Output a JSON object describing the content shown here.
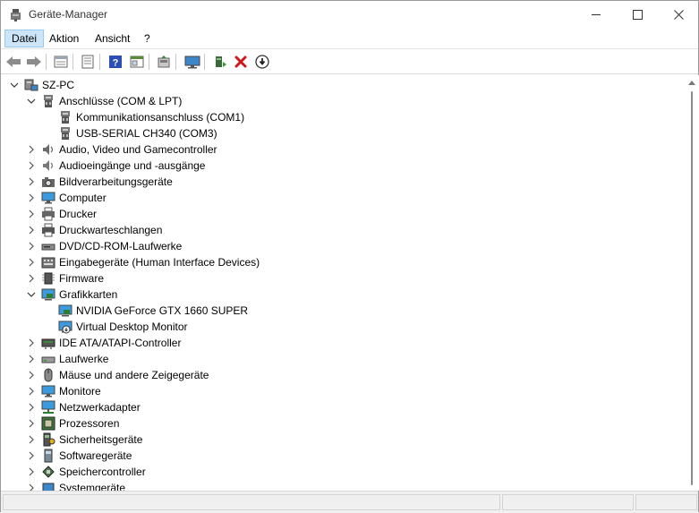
{
  "window": {
    "title": "Geräte-Manager"
  },
  "menu": {
    "items": [
      "Datei",
      "Aktion",
      "Ansicht",
      "?"
    ]
  },
  "tree": {
    "root": "SZ-PC",
    "nodes": [
      "Anschlüsse (COM & LPT)",
      "Kommunikationsanschluss (COM1)",
      "USB-SERIAL CH340 (COM3)",
      "Audio, Video und Gamecontroller",
      "Audioeingänge und -ausgänge",
      "Bildverarbeitungsgeräte",
      "Computer",
      "Drucker",
      "Druckwarteschlangen",
      "DVD/CD-ROM-Laufwerke",
      "Eingabegeräte (Human Interface Devices)",
      "Firmware",
      "Grafikkarten",
      "NVIDIA GeForce GTX 1660 SUPER",
      "Virtual Desktop Monitor",
      "IDE ATA/ATAPI-Controller",
      "Laufwerke",
      "Mäuse und andere Zeigegeräte",
      "Monitore",
      "Netzwerkadapter",
      "Prozessoren",
      "Sicherheitsgeräte",
      "Softwaregeräte",
      "Speichercontroller",
      "Systemgeräte"
    ]
  }
}
